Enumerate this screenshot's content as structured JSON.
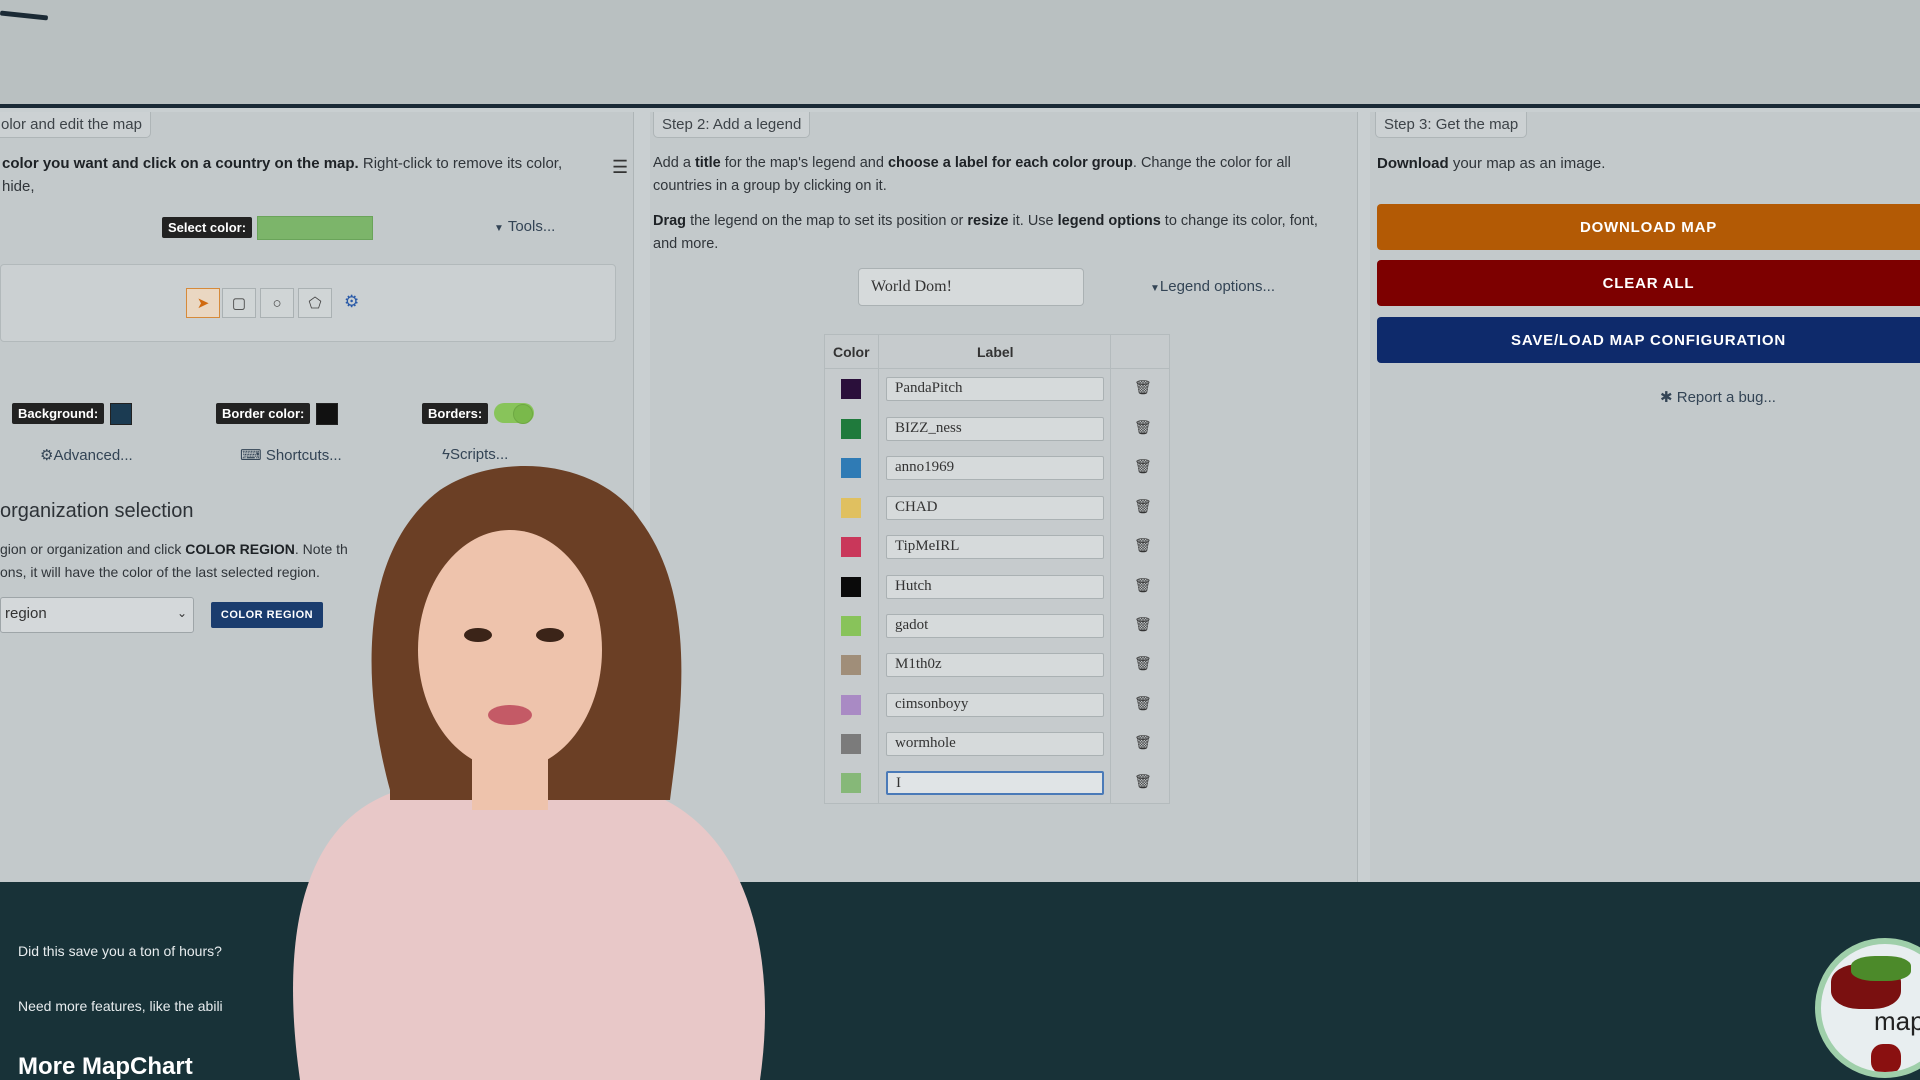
{
  "colors": {
    "download": "#b35a05",
    "clear": "#7d0000",
    "saveload": "#0e2a6b",
    "footer_bg": "#183238",
    "select_color_value": "#7cb56a",
    "background_swatch": "#1b3b52",
    "border_swatch": "#111111"
  },
  "step1": {
    "tab": "olor and edit the map",
    "instr_bold": "color you want and click on a country on the map.",
    "instr_rest": "Right-click to remove its color, hide,",
    "select_color_label": "Select color:",
    "tools_link": "Tools...",
    "background_label": "Background:",
    "border_color_label": "Border color:",
    "borders_label": "Borders:",
    "advanced_link": "Advanced...",
    "shortcuts_link": "Shortcuts...",
    "scripts_link": "Scripts...",
    "org_title": "organization selection",
    "org_line1_a": "gion or organization and click",
    "org_line1_b": "COLOR REGION",
    "org_line1_c": ". Note th",
    "org_line2": "ons, it will have the color of the last selected region.",
    "region_select": "region",
    "color_region_btn": "COLOR REGION"
  },
  "step2": {
    "tab": "Step 2: Add a legend",
    "p1_a": "Add a",
    "p1_b": "title",
    "p1_c": "for the map's legend and",
    "p1_d": "choose a label for each color group",
    "p1_e": ". Change the color for all",
    "p1_line2": "countries in a group by clicking on it.",
    "p2_a": "Drag",
    "p2_b": "the legend on the map to set its position or",
    "p2_c": "resize",
    "p2_d": "it. Use",
    "p2_e": "legend options",
    "p2_f": "to change its color, font,",
    "p2_line2": "and more.",
    "legend_title_value": "World Dom!",
    "legend_options": "Legend options...",
    "col_color": "Color",
    "col_label": "Label",
    "rows": [
      {
        "color": "#2a0f3a",
        "label": "PandaPitch"
      },
      {
        "color": "#1f7a3c",
        "label": "BIZZ_ness"
      },
      {
        "color": "#2f7bb5",
        "label": "anno1969"
      },
      {
        "color": "#e0c060",
        "label": "CHAD"
      },
      {
        "color": "#c9375a",
        "label": "TipMeIRL"
      },
      {
        "color": "#0a0a0a",
        "label": "Hutch"
      },
      {
        "color": "#88c35a",
        "label": "gadot"
      },
      {
        "color": "#a08e79",
        "label": "M1th0z"
      },
      {
        "color": "#a98ac4",
        "label": "cimsonboyy"
      },
      {
        "color": "#7b7b7b",
        "label": "wormhole"
      },
      {
        "color": "#86b878",
        "label": "I"
      }
    ]
  },
  "step3": {
    "tab": "Step 3: Get the map",
    "p_bold": "Download",
    "p_rest": "your map as an image.",
    "download_btn": "DOWNLOAD MAP",
    "clear_btn": "CLEAR ALL",
    "saveload_btn": "SAVE/LOAD MAP CONFIGURATION",
    "report_link": "Report a bug..."
  },
  "footer": {
    "line1": "Did this save you a ton of hours?",
    "line2": "Need more features, like the abili",
    "title": "More MapChart",
    "logo_text": "mapcha"
  }
}
